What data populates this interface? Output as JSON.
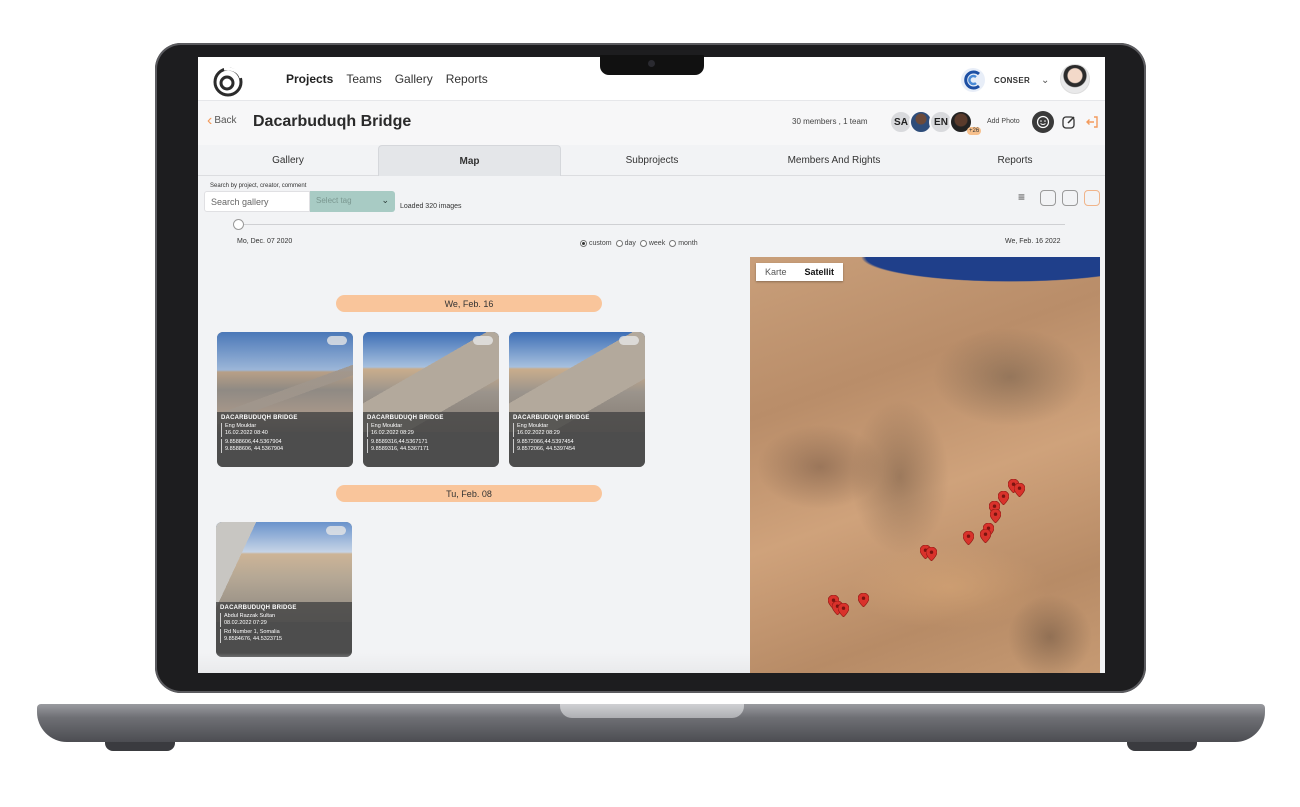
{
  "nav": {
    "items": [
      "Projects",
      "Teams",
      "Gallery",
      "Reports"
    ],
    "active": "Projects"
  },
  "company": {
    "name": "CONSER"
  },
  "project": {
    "back_label": "Back",
    "title": "Dacarbuduqh Bridge",
    "members_text": "30 members , 1 team",
    "avatar_initials": [
      "SA",
      "EN"
    ],
    "more_count": "+26",
    "add_photo_label": "Add Photo"
  },
  "tabs": [
    "Gallery",
    "Map",
    "Subprojects",
    "Members And Rights",
    "Reports"
  ],
  "active_tab": "Map",
  "filters": {
    "search_label": "Search by project, creator, comment",
    "search_placeholder": "Search gallery",
    "tag_placeholder": "Select tag",
    "loaded_text": "Loaded 320 images"
  },
  "timeline": {
    "start_date": "Mo, Dec. 07 2020",
    "end_date": "We, Feb. 16 2022",
    "ranges": [
      "custom",
      "day",
      "week",
      "month"
    ],
    "selected_range": "custom"
  },
  "groups": [
    {
      "date": "We, Feb. 16",
      "photos": [
        {
          "project": "DACARBUDUQH BRIDGE",
          "creator": "Eng Mouktar",
          "datetime": "16.02.2022 08:40",
          "coord1": "9.8588606,44.5367904",
          "coord2": "9.8588606, 44.5367904"
        },
        {
          "project": "DACARBUDUQH BRIDGE",
          "creator": "Eng Mouktar",
          "datetime": "16.02.2022 08:29",
          "coord1": "9.8589316,44.5367171",
          "coord2": "9.8589316, 44.5367171"
        },
        {
          "project": "DACARBUDUQH BRIDGE",
          "creator": "Eng Mouktar",
          "datetime": "16.02.2022 08:29",
          "coord1": "9.8572066,44.5397454",
          "coord2": "9.8572066, 44.5397454"
        }
      ]
    },
    {
      "date": "Tu, Feb. 08",
      "photos": [
        {
          "project": "DACARBUDUQH BRIDGE",
          "creator": "Abdul Razzak Sultan",
          "datetime": "08.02.2022 07:29",
          "coord1": "Rd Number 1, Somalia",
          "coord2": "9.8584676, 44.5323715"
        }
      ]
    }
  ],
  "map": {
    "type_options": [
      "Karte",
      "Satellit"
    ],
    "selected_type": "Satellit",
    "marker_count": 14
  },
  "colors": {
    "accent_orange": "#f39b5d",
    "date_pill": "#f9c59b",
    "tag_select": "#a8cbc4",
    "marker_red": "#d9322b"
  }
}
